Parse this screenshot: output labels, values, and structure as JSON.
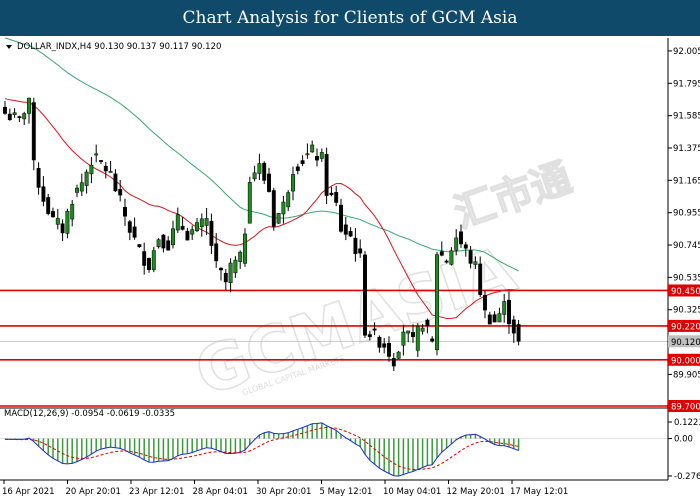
{
  "banner": {
    "title": "Chart Analysis for Clients of GCM Asia"
  },
  "header": {
    "symbol_line": "DOLLAR_INDX,H4  90.130 90.137 90.117 90.120"
  },
  "macd": {
    "label": "MACD(12,26,9) -0.0954 -0.0619 -0.0335"
  },
  "watermark": {
    "text": "GCMASIA",
    "text_cn": "汇市通",
    "subtext": "GLOBAL CAPITAL MARKETS"
  },
  "colors": {
    "banner": "#0f4a6b",
    "bull": "#1f8a1f",
    "bear": "#000000",
    "ma_fast": "#d9151e",
    "ma_slow": "#38a870",
    "level": "#e00000",
    "macd_line": "#1c2bd6",
    "signal_line": "#e00000",
    "hist": "#3a9a3a"
  },
  "chart_data": [
    {
      "type": "candlestick",
      "symbol": "DOLLAR_INDX",
      "timeframe": "H4",
      "ohlc_readout": {
        "open": 90.13,
        "high": 90.137,
        "low": 90.117,
        "close": 90.12
      },
      "last_price": 90.12,
      "ylim": [
        89.7,
        92.05
      ],
      "y_ticks": [
        92.005,
        91.795,
        91.585,
        91.375,
        91.165,
        90.955,
        90.745,
        90.535,
        90.325,
        89.905
      ],
      "x_labels": [
        "16 Apr 2021",
        "20 Apr 20:01",
        "23 Apr 12:01",
        "28 Apr 04:01",
        "30 Apr 20:01",
        "5 May 12:01",
        "10 May 04:01",
        "12 May 20:01",
        "17 May 12:01"
      ],
      "levels": [
        90.45,
        90.22,
        90.0,
        89.7
      ],
      "path_points": [
        [
          0,
          91.6
        ],
        [
          3,
          91.55
        ],
        [
          5,
          91.7
        ],
        [
          6,
          91.25
        ],
        [
          8,
          91.05
        ],
        [
          10,
          90.9
        ],
        [
          12,
          90.85
        ],
        [
          14,
          91.05
        ],
        [
          16,
          91.15
        ],
        [
          18,
          91.3
        ],
        [
          20,
          91.28
        ],
        [
          22,
          91.2
        ],
        [
          24,
          91.02
        ],
        [
          26,
          90.85
        ],
        [
          28,
          90.7
        ],
        [
          30,
          90.62
        ],
        [
          32,
          90.8
        ],
        [
          34,
          90.75
        ],
        [
          36,
          90.9
        ],
        [
          38,
          90.82
        ],
        [
          40,
          90.85
        ],
        [
          42,
          90.9
        ],
        [
          44,
          90.6
        ],
        [
          46,
          90.5
        ],
        [
          47,
          90.6
        ],
        [
          49,
          90.65
        ],
        [
          50,
          90.85
        ],
        [
          51,
          91.2
        ],
        [
          53,
          91.25
        ],
        [
          55,
          91.1
        ],
        [
          56,
          90.9
        ],
        [
          58,
          91.0
        ],
        [
          60,
          91.25
        ],
        [
          62,
          91.3
        ],
        [
          64,
          91.35
        ],
        [
          66,
          91.3
        ],
        [
          67,
          91.1
        ],
        [
          69,
          91.0
        ],
        [
          70,
          90.85
        ],
        [
          72,
          90.8
        ],
        [
          74,
          90.65
        ],
        [
          75,
          90.2
        ],
        [
          77,
          90.15
        ],
        [
          79,
          90.1
        ],
        [
          81,
          90.0
        ],
        [
          83,
          90.2
        ],
        [
          85,
          90.1
        ],
        [
          87,
          90.25
        ],
        [
          89,
          90.1
        ],
        [
          90,
          90.7
        ],
        [
          92,
          90.65
        ],
        [
          94,
          90.8
        ],
        [
          96,
          90.7
        ],
        [
          98,
          90.6
        ],
        [
          100,
          90.3
        ],
        [
          102,
          90.25
        ],
        [
          104,
          90.35
        ],
        [
          106,
          90.2
        ],
        [
          107,
          90.12
        ]
      ],
      "ma_fast": {
        "color": "#d9151e"
      },
      "ma_slow": {
        "color": "#38a870"
      }
    },
    {
      "type": "macd",
      "params": [
        12,
        26,
        9
      ],
      "values": {
        "macd": -0.0954,
        "signal": -0.0619,
        "hist": -0.0335
      },
      "ylim": [
        -0.2766,
        0.1223
      ],
      "y_ticks": [
        0.1223,
        0.0,
        -0.2766
      ]
    }
  ]
}
